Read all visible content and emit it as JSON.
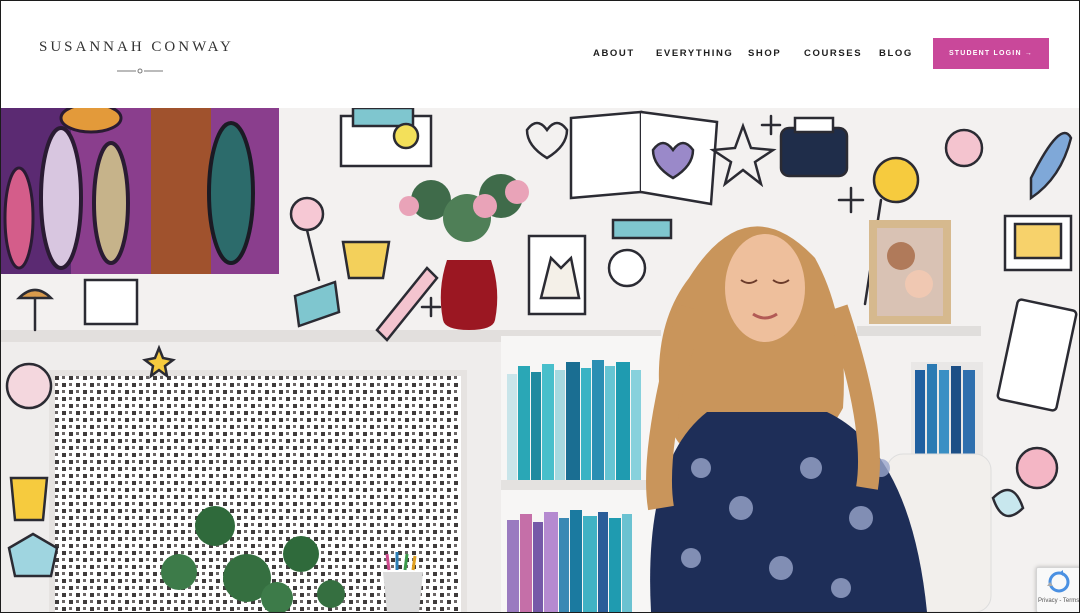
{
  "site": {
    "logo_text": "SUSANNAH CONWAY"
  },
  "nav": {
    "items": [
      {
        "label": "ABOUT"
      },
      {
        "label": "EVERYTHING"
      },
      {
        "label": "SHOP"
      },
      {
        "label": "COURSES"
      },
      {
        "label": "BLOG"
      }
    ],
    "login_button": "STUDENT LOGIN →"
  },
  "hero": {
    "image_description_icon": "hero-photo"
  },
  "recaptcha": {
    "label": "Privacy - Terms",
    "icon": "recaptcha-icon"
  },
  "colors": {
    "accent": "#c9489a",
    "nav_text": "#1e1e1e",
    "logo_text": "#333333"
  }
}
